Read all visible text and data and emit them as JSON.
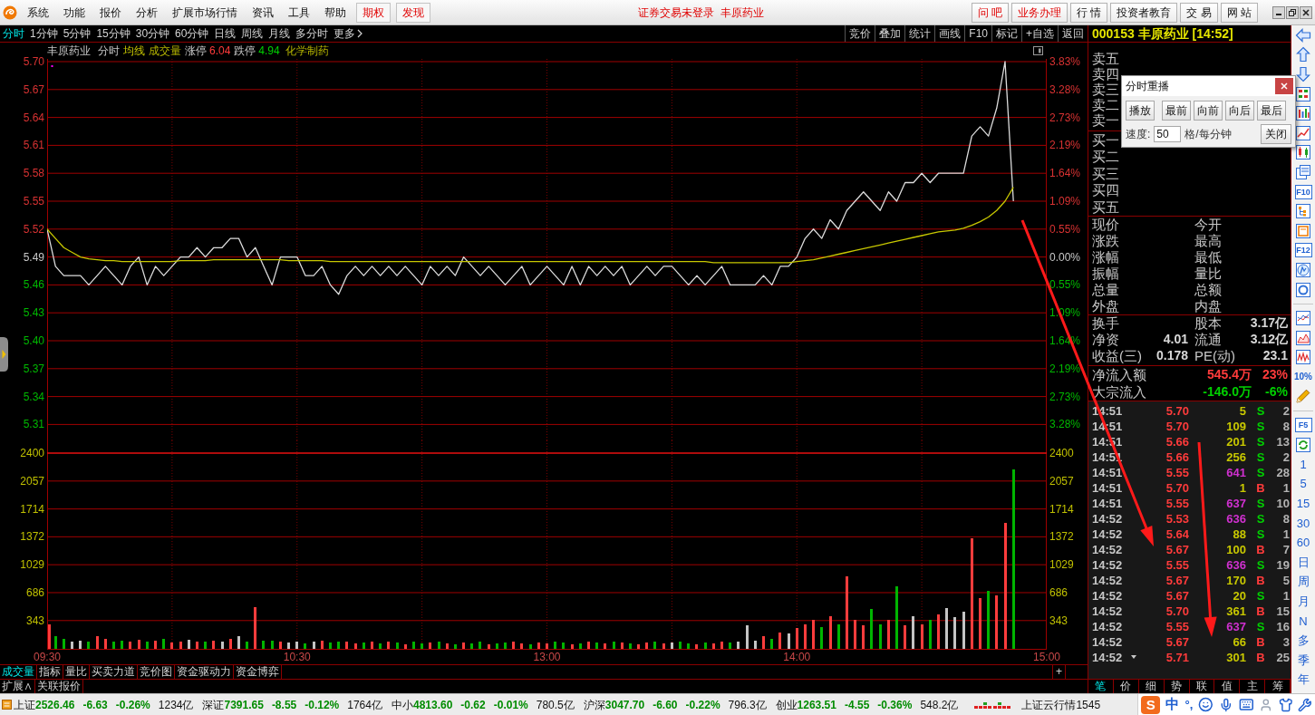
{
  "menu_bar": {
    "items": [
      "系统",
      "功能",
      "报价",
      "分析",
      "扩展市场行情",
      "资讯",
      "工具",
      "帮助"
    ],
    "feature_buttons": [
      "期权",
      "发现"
    ],
    "status_text": "证券交易未登录  丰原药业",
    "links": [
      {
        "label": "问 吧",
        "kind": "accent"
      },
      {
        "label": "业务办理",
        "kind": "accent"
      },
      {
        "label": "行 情",
        "kind": "plain"
      },
      {
        "label": "投资者教育",
        "kind": "plain"
      },
      {
        "label": "交 易",
        "kind": "plain"
      },
      {
        "label": "网 站",
        "kind": "plain"
      }
    ]
  },
  "period_bar": {
    "periods": [
      {
        "label": "分时",
        "selected": true
      },
      {
        "label": "1分钟",
        "selected": false
      },
      {
        "label": "5分钟",
        "selected": false
      },
      {
        "label": "15分钟",
        "selected": false
      },
      {
        "label": "30分钟",
        "selected": false
      },
      {
        "label": "60分钟",
        "selected": false
      },
      {
        "label": "日线",
        "selected": false
      },
      {
        "label": "周线",
        "selected": false
      },
      {
        "label": "月线",
        "selected": false
      },
      {
        "label": "多分时",
        "selected": false
      }
    ],
    "more": "更多",
    "tools": [
      "竞价",
      "叠加",
      "统计",
      "画线",
      "F10",
      "标记",
      "+自选",
      "返回"
    ]
  },
  "price_chart": {
    "header": {
      "name": "丰原药业",
      "limit_up_label": "涨停",
      "limit_up": "6.04",
      "limit_down_label": "跌停",
      "limit_down": "4.94",
      "sector": "化学制药"
    },
    "right_axis": [
      {
        "label": "3.83%",
        "kind": "up"
      },
      {
        "label": "3.28%",
        "kind": "up"
      },
      {
        "label": "2.73%",
        "kind": "up"
      },
      {
        "label": "2.19%",
        "kind": "up"
      },
      {
        "label": "1.64%",
        "kind": "up"
      },
      {
        "label": "1.09%",
        "kind": "up"
      },
      {
        "label": "0.55%",
        "kind": "up"
      },
      {
        "label": "0.00%",
        "kind": "flat"
      },
      {
        "label": "0.55%",
        "kind": "down"
      },
      {
        "label": "1.09%",
        "kind": "down"
      },
      {
        "label": "1.64%",
        "kind": "down"
      },
      {
        "label": "2.19%",
        "kind": "down"
      },
      {
        "label": "2.73%",
        "kind": "down"
      },
      {
        "label": "3.28%",
        "kind": "down"
      }
    ],
    "chart_data": {
      "type": "line",
      "grid": true,
      "categories": [
        null,
        null,
        null,
        null,
        null,
        null,
        null,
        null,
        null,
        null,
        null,
        null,
        null,
        null,
        null,
        null,
        null,
        null,
        null,
        null,
        null,
        null,
        null,
        null,
        null,
        null,
        null,
        null,
        null,
        null,
        null,
        null,
        null,
        null,
        null,
        null,
        null,
        null,
        null,
        null,
        null,
        null,
        null,
        null,
        null,
        null,
        null,
        null,
        null,
        null,
        null,
        null,
        null,
        null,
        null,
        null,
        null,
        null,
        null,
        null,
        null,
        null,
        null,
        null,
        null,
        null,
        null,
        null,
        null,
        null,
        null,
        null,
        null,
        null,
        null,
        null,
        null,
        null,
        null,
        null,
        null,
        null,
        null,
        null,
        null,
        null,
        null,
        null,
        null,
        null,
        null,
        null,
        null,
        null,
        null,
        null,
        null,
        null,
        null,
        null,
        null,
        null,
        null,
        null,
        null,
        null,
        null,
        null,
        null,
        null,
        null,
        null,
        null,
        null,
        null,
        null,
        null,
        null,
        null,
        null,
        null
      ],
      "series": [
        {
          "name": "分时",
          "color": "#dcdcdc",
          "values": [
            5.52,
            5.48,
            5.47,
            5.47,
            5.47,
            5.46,
            5.47,
            5.48,
            5.47,
            5.46,
            5.48,
            5.49,
            5.46,
            5.48,
            5.47,
            5.48,
            5.49,
            5.49,
            5.5,
            5.49,
            5.5,
            5.5,
            5.51,
            5.51,
            5.49,
            5.5,
            5.48,
            5.46,
            5.49,
            5.49,
            5.49,
            5.47,
            5.47,
            5.48,
            5.46,
            5.45,
            5.47,
            5.48,
            5.47,
            5.48,
            5.47,
            5.48,
            5.47,
            5.48,
            5.47,
            5.46,
            5.48,
            5.47,
            5.48,
            5.47,
            5.49,
            5.48,
            5.47,
            5.48,
            5.47,
            5.46,
            5.47,
            5.48,
            5.46,
            5.47,
            5.48,
            5.47,
            5.46,
            5.48,
            5.46,
            5.48,
            5.47,
            5.48,
            5.47,
            5.48,
            5.46,
            5.47,
            5.48,
            5.47,
            5.48,
            5.48,
            5.47,
            5.46,
            5.47,
            5.46,
            5.47,
            5.48,
            5.46,
            5.46,
            5.46,
            5.46,
            5.47,
            5.46,
            5.48,
            5.48,
            5.49,
            5.51,
            5.52,
            5.51,
            5.53,
            5.52,
            5.54,
            5.55,
            5.56,
            5.55,
            5.54,
            5.56,
            5.55,
            5.57,
            5.57,
            5.58,
            5.57,
            5.58,
            5.58,
            5.58,
            5.58,
            5.62,
            5.63,
            5.62,
            5.65,
            5.7,
            5.55,
            null,
            null,
            null,
            null
          ]
        },
        {
          "name": "均线",
          "color": "#c8c800",
          "values": [
            5.52,
            5.51,
            5.5,
            5.495,
            5.49,
            5.488,
            5.487,
            5.486,
            5.486,
            5.485,
            5.485,
            5.485,
            5.485,
            5.485,
            5.485,
            5.485,
            5.486,
            5.486,
            5.486,
            5.486,
            5.487,
            5.487,
            5.487,
            5.487,
            5.487,
            5.487,
            5.487,
            5.487,
            5.487,
            5.486,
            5.486,
            5.486,
            5.486,
            5.486,
            5.485,
            5.485,
            5.485,
            5.485,
            5.485,
            5.485,
            5.485,
            5.485,
            5.485,
            5.485,
            5.485,
            5.485,
            5.485,
            5.485,
            5.485,
            5.485,
            5.485,
            5.485,
            5.485,
            5.485,
            5.485,
            5.485,
            5.485,
            5.485,
            5.485,
            5.485,
            5.485,
            5.485,
            5.485,
            5.485,
            5.485,
            5.485,
            5.485,
            5.485,
            5.485,
            5.485,
            5.485,
            5.485,
            5.485,
            5.485,
            5.485,
            5.485,
            5.485,
            5.485,
            5.485,
            5.485,
            5.484,
            5.484,
            5.484,
            5.484,
            5.484,
            5.484,
            5.484,
            5.484,
            5.484,
            5.484,
            5.485,
            5.486,
            5.487,
            5.489,
            5.491,
            5.493,
            5.495,
            5.497,
            5.499,
            5.501,
            5.503,
            5.505,
            5.507,
            5.509,
            5.511,
            5.513,
            5.515,
            5.517,
            5.518,
            5.519,
            5.521,
            5.524,
            5.528,
            5.533,
            5.54,
            5.55,
            5.565,
            null,
            null,
            null,
            null
          ]
        }
      ],
      "ylim": [
        5.31,
        5.7
      ],
      "yticks": [
        {
          "value": 5.7,
          "label": "5.70"
        },
        {
          "value": 5.67,
          "label": "5.67"
        },
        {
          "value": 5.64,
          "label": "5.64"
        },
        {
          "value": 5.61,
          "label": "5.61"
        },
        {
          "value": 5.58,
          "label": "5.58"
        },
        {
          "value": 5.55,
          "label": "5.55"
        },
        {
          "value": 5.52,
          "label": "5.52"
        },
        {
          "value": 5.49,
          "label": "5.49"
        },
        {
          "value": 5.46,
          "label": "5.46"
        },
        {
          "value": 5.43,
          "label": "5.43"
        },
        {
          "value": 5.4,
          "label": "5.40"
        },
        {
          "value": 5.37,
          "label": "5.37"
        },
        {
          "value": 5.34,
          "label": "5.34"
        },
        {
          "value": 5.31,
          "label": "5.31"
        }
      ]
    }
  },
  "volume_chart": {
    "right_axis": [
      "2400",
      "2057",
      "1714",
      "1372",
      "1029",
      "686",
      "343"
    ],
    "chart_data": {
      "type": "bar",
      "grid": true,
      "categories": [
        "09:30",
        null,
        null,
        null,
        null,
        null,
        null,
        null,
        null,
        null,
        null,
        null,
        null,
        null,
        null,
        null,
        null,
        null,
        null,
        null,
        null,
        null,
        null,
        null,
        null,
        null,
        null,
        null,
        null,
        null,
        "10:30",
        null,
        null,
        null,
        null,
        null,
        null,
        null,
        null,
        null,
        null,
        null,
        null,
        null,
        null,
        null,
        null,
        null,
        null,
        null,
        null,
        null,
        null,
        null,
        null,
        null,
        null,
        null,
        null,
        null,
        "13:00",
        null,
        null,
        null,
        null,
        null,
        null,
        null,
        null,
        null,
        null,
        null,
        null,
        null,
        null,
        null,
        null,
        null,
        null,
        null,
        null,
        null,
        null,
        null,
        null,
        null,
        null,
        null,
        null,
        null,
        "14:00",
        null,
        null,
        null,
        null,
        null,
        null,
        null,
        null,
        null,
        null,
        null,
        null,
        null,
        null,
        null,
        null,
        null,
        null,
        null,
        null,
        null,
        null,
        null,
        null,
        null,
        null,
        null,
        null,
        null,
        "15:00"
      ],
      "series": [
        {
          "name": "成交量",
          "values": [
            300,
            150,
            120,
            80,
            100,
            90,
            150,
            120,
            80,
            100,
            90,
            110,
            80,
            100,
            120,
            70,
            90,
            110,
            80,
            90,
            100,
            80,
            120,
            150,
            90,
            510,
            100,
            100,
            80,
            70,
            90,
            60,
            80,
            100,
            70,
            90,
            80,
            60,
            70,
            90,
            60,
            80,
            70,
            50,
            90,
            60,
            70,
            80,
            60,
            50,
            70,
            60,
            80,
            50,
            60,
            70,
            90,
            60,
            50,
            70,
            60,
            80,
            70,
            50,
            60,
            90,
            70,
            60,
            80,
            70,
            60,
            50,
            70,
            80,
            60,
            70,
            90,
            60,
            50,
            70,
            60,
            80,
            70,
            90,
            280,
            100,
            150,
            120,
            200,
            180,
            250,
            300,
            350,
            260,
            400,
            300,
            890,
            350,
            280,
            490,
            300,
            350,
            760,
            280,
            400,
            300,
            350,
            420,
            500,
            380,
            450,
            1350,
            620,
            710,
            650,
            1540,
            2200,
            null,
            null,
            null,
            null
          ]
        }
      ],
      "ylim": [
        0,
        2400
      ],
      "yticks": [
        {
          "value": 2400,
          "label": "2400"
        },
        {
          "value": 2057,
          "label": "2057"
        },
        {
          "value": 1714,
          "label": "1714"
        },
        {
          "value": 1372,
          "label": "1372"
        },
        {
          "value": 1029,
          "label": "1029"
        },
        {
          "value": 686,
          "label": "686"
        },
        {
          "value": 343,
          "label": "343"
        }
      ]
    }
  },
  "indicator_tabs": {
    "tabs": [
      {
        "label": "成交量",
        "selected": true
      },
      {
        "label": "指标",
        "selected": false
      },
      {
        "label": "量比",
        "selected": false
      },
      {
        "label": "买卖力道",
        "selected": false
      },
      {
        "label": "竞价图",
        "selected": false
      },
      {
        "label": "资金驱动力",
        "selected": false
      },
      {
        "label": "资金博弈",
        "selected": false
      }
    ],
    "add": "+"
  },
  "expand_row": {
    "buttons": [
      "扩展∧",
      "关联报价"
    ]
  },
  "quote_panel": {
    "title": "000153 丰原药业 [14:52]",
    "sell_levels": [
      "卖五",
      "卖四",
      "卖三",
      "卖二",
      "卖一"
    ],
    "buy_levels": [
      "买一",
      "买二",
      "买三",
      "买四",
      "买五"
    ],
    "fields": [
      {
        "left": "现价",
        "right": "今开"
      },
      {
        "left": "涨跌",
        "right": "最高"
      },
      {
        "left": "涨幅",
        "right": "最低"
      },
      {
        "left": "振幅",
        "right": "量比"
      },
      {
        "left": "总量",
        "right": "总额"
      },
      {
        "left": "外盘",
        "right": "内盘"
      }
    ],
    "stats": [
      {
        "label": "换手",
        "right_label": "股本",
        "right_value": "3.17亿"
      },
      {
        "label": "净资",
        "value": "4.01",
        "right_label": "流通",
        "right_value": "3.12亿"
      },
      {
        "label": "收益(三)",
        "value": "0.178",
        "right_label": "PE(动)",
        "right_value": "23.1"
      }
    ],
    "flows": [
      {
        "label": "净流入额",
        "amount": "545.4万",
        "percent": "23%",
        "kind": "up"
      },
      {
        "label": "大宗流入",
        "amount": "-146.0万",
        "percent": "-6%",
        "kind": "down"
      }
    ],
    "ticks": [
      {
        "time": "14:51",
        "price": "5.70",
        "volume": "5",
        "side": "S",
        "count": "2",
        "kind": "sell",
        "color": "#c8c800"
      },
      {
        "time": "14:51",
        "price": "5.70",
        "volume": "109",
        "side": "S",
        "count": "8",
        "kind": "sell",
        "color": "#c8c800"
      },
      {
        "time": "14:51",
        "price": "5.66",
        "volume": "201",
        "side": "S",
        "count": "13",
        "kind": "sell",
        "color": "#c8c800"
      },
      {
        "time": "14:51",
        "price": "5.66",
        "volume": "256",
        "side": "S",
        "count": "2",
        "kind": "sell",
        "color": "#c8c800"
      },
      {
        "time": "14:51",
        "price": "5.55",
        "volume": "641",
        "side": "S",
        "count": "28",
        "kind": "sell",
        "color": "#d030d0"
      },
      {
        "time": "14:51",
        "price": "5.70",
        "volume": "1",
        "side": "B",
        "count": "1",
        "kind": "buy",
        "color": "#c8c800"
      },
      {
        "time": "14:51",
        "price": "5.55",
        "volume": "637",
        "side": "S",
        "count": "10",
        "kind": "sell",
        "color": "#d030d0"
      },
      {
        "time": "14:52",
        "price": "5.53",
        "volume": "636",
        "side": "S",
        "count": "8",
        "kind": "sell",
        "color": "#d030d0"
      },
      {
        "time": "14:52",
        "price": "5.64",
        "volume": "88",
        "side": "S",
        "count": "1",
        "kind": "sell",
        "color": "#c8c800"
      },
      {
        "time": "14:52",
        "price": "5.67",
        "volume": "100",
        "side": "B",
        "count": "7",
        "kind": "buy",
        "color": "#c8c800"
      },
      {
        "time": "14:52",
        "price": "5.55",
        "volume": "636",
        "side": "S",
        "count": "19",
        "kind": "sell",
        "color": "#d030d0"
      },
      {
        "time": "14:52",
        "price": "5.67",
        "volume": "170",
        "side": "B",
        "count": "5",
        "kind": "buy",
        "color": "#c8c800"
      },
      {
        "time": "14:52",
        "price": "5.67",
        "volume": "20",
        "side": "S",
        "count": "1",
        "kind": "sell",
        "color": "#c8c800"
      },
      {
        "time": "14:52",
        "price": "5.70",
        "volume": "361",
        "side": "B",
        "count": "15",
        "kind": "buy",
        "color": "#c8c800"
      },
      {
        "time": "14:52",
        "price": "5.55",
        "volume": "637",
        "side": "S",
        "count": "16",
        "kind": "sell",
        "color": "#d030d0"
      },
      {
        "time": "14:52",
        "price": "5.67",
        "volume": "66",
        "side": "B",
        "count": "3",
        "kind": "buy",
        "color": "#c8c800"
      },
      {
        "time": "14:52",
        "price": "5.71",
        "volume": "301",
        "side": "B",
        "count": "25",
        "kind": "buy",
        "color": "#c8c800"
      }
    ],
    "tabs": [
      {
        "label": "笔",
        "selected": true
      },
      {
        "label": "价",
        "selected": false
      },
      {
        "label": "细",
        "selected": false
      },
      {
        "label": "势",
        "selected": false
      },
      {
        "label": "联",
        "selected": false
      },
      {
        "label": "值",
        "selected": false
      },
      {
        "label": "主",
        "selected": false
      },
      {
        "label": "筹",
        "selected": false
      }
    ]
  },
  "replay_dialog": {
    "title": "分时重播",
    "buttons": [
      "播放",
      "最前",
      "向前",
      "向后",
      "最后"
    ],
    "speed_label": "速度:",
    "speed": "50",
    "unit": "格/每分钟",
    "close_button": "关闭"
  },
  "right_toolbar": {
    "labels": [
      "F10",
      "F12",
      "10%",
      "F5"
    ],
    "periods": [
      "1",
      "5",
      "15",
      "30",
      "60",
      "日",
      "周",
      "月",
      "N",
      "多",
      "季",
      "年"
    ]
  },
  "status_bar": {
    "indices": [
      {
        "name": "上证",
        "value": "2526.46",
        "change": "-6.63",
        "percent": "-0.26%",
        "amount": "1234亿",
        "kind": "down"
      },
      {
        "name": "深证",
        "value": "7391.65",
        "change": "-8.55",
        "percent": "-0.12%",
        "amount": "1764亿",
        "kind": "down"
      },
      {
        "name": "中小",
        "value": "4813.60",
        "change": "-0.62",
        "percent": "-0.01%",
        "amount": "780.5亿",
        "kind": "down"
      },
      {
        "name": "沪深",
        "value": "3047.70",
        "change": "-6.60",
        "percent": "-0.22%",
        "amount": "796.3亿",
        "kind": "down"
      },
      {
        "name": "创业",
        "value": "1263.51",
        "change": "-4.55",
        "percent": "-0.36%",
        "amount": "548.2亿",
        "kind": "down"
      }
    ],
    "cloud": "上证云行情1545"
  },
  "ime_toolbar": {
    "logo": "S",
    "mode": "中",
    "punctuation": "°,"
  }
}
